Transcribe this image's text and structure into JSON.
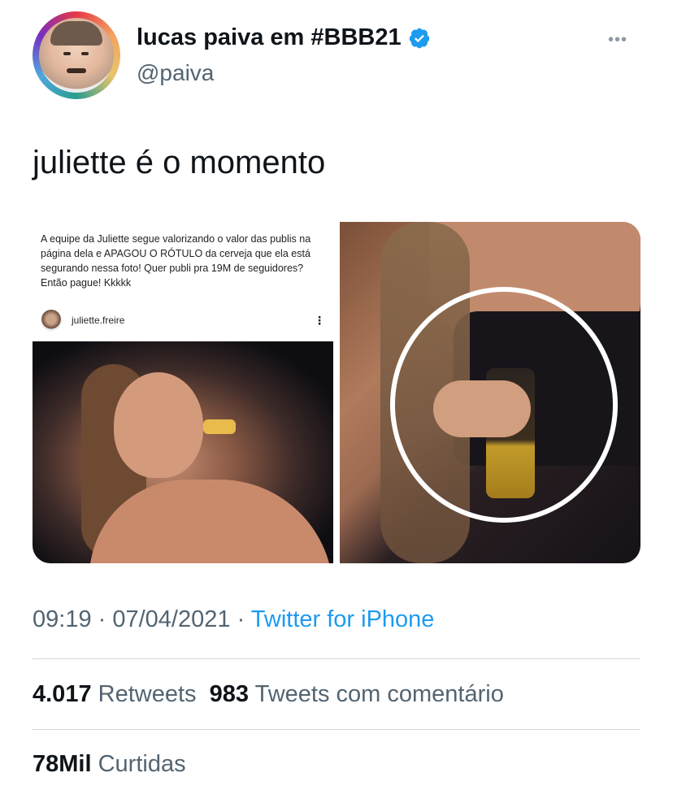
{
  "user": {
    "name": "lucas paiva em #BBB21",
    "handle": "@paiva",
    "verified": true
  },
  "tweet": {
    "text": "juliette é o momento"
  },
  "media": {
    "left_caption": "A equipe da Juliette segue valorizando o valor das publis na página dela e APAGOU O RÓTULO da cerveja que ela está segurando nessa foto! Quer publi pra 19M de seguidores? Então pague! Kkkkk",
    "ig_username": "juliette.freire"
  },
  "meta": {
    "time": "09:19",
    "separator1": " · ",
    "date": "07/04/2021",
    "separator2": " · ",
    "source": "Twitter for iPhone"
  },
  "stats": {
    "retweets_count": "4.017",
    "retweets_label": "Retweets",
    "quotes_count": "983",
    "quotes_label": "Tweets com comentário",
    "likes_count": "78Mil",
    "likes_label": "Curtidas"
  },
  "colors": {
    "verified": "#1d9bf0",
    "link": "#1d9bf0",
    "secondary_text": "#536471"
  },
  "icons": {
    "more": "more-horizontal-icon",
    "verified": "verified-badge-icon"
  }
}
